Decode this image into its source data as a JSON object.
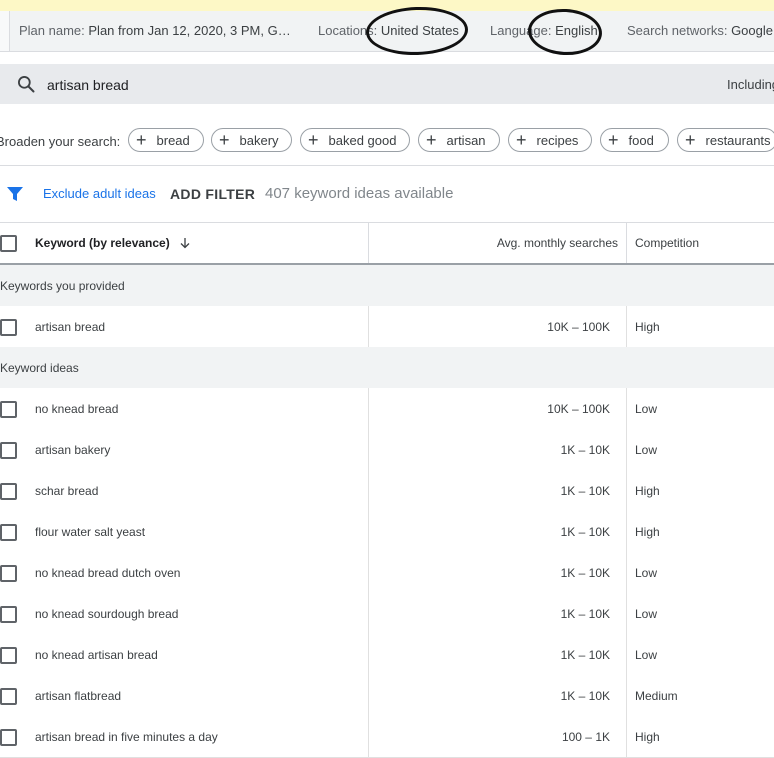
{
  "plan_bar": {
    "plan_label": "Plan name:",
    "plan_value": "Plan from Jan 12, 2020, 3 PM, G…",
    "location_label": "Locations:",
    "location_value": "United States",
    "language_label": "Language:",
    "language_value": "English",
    "networks_label": "Search networks:",
    "networks_value": "Google"
  },
  "search": {
    "query": "artisan bread",
    "right_text": "Including"
  },
  "broaden": {
    "label": "Broaden your search:",
    "chips": [
      "bread",
      "bakery",
      "baked good",
      "artisan",
      "recipes",
      "food",
      "restaurants"
    ]
  },
  "filters": {
    "exclude_label": "Exclude adult ideas",
    "add_filter_label": "ADD FILTER",
    "ideas_count": "407 keyword ideas available"
  },
  "table": {
    "headers": {
      "keyword": "Keyword (by relevance)",
      "avg": "Avg. monthly searches",
      "competition": "Competition"
    },
    "group_provided": "Keywords you provided",
    "provided_rows": [
      {
        "keyword": "artisan bread",
        "avg": "10K – 100K",
        "competition": "High"
      }
    ],
    "group_ideas": "Keyword ideas",
    "idea_rows": [
      {
        "keyword": "no knead bread",
        "avg": "10K – 100K",
        "competition": "Low"
      },
      {
        "keyword": "artisan bakery",
        "avg": "1K – 10K",
        "competition": "Low"
      },
      {
        "keyword": "schar bread",
        "avg": "1K – 10K",
        "competition": "High"
      },
      {
        "keyword": "flour water salt yeast",
        "avg": "1K – 10K",
        "competition": "High"
      },
      {
        "keyword": "no knead bread dutch oven",
        "avg": "1K – 10K",
        "competition": "Low"
      },
      {
        "keyword": "no knead sourdough bread",
        "avg": "1K – 10K",
        "competition": "Low"
      },
      {
        "keyword": "no knead artisan bread",
        "avg": "1K – 10K",
        "competition": "Low"
      },
      {
        "keyword": "artisan flatbread",
        "avg": "1K – 10K",
        "competition": "Medium"
      },
      {
        "keyword": "artisan bread in five minutes a day",
        "avg": "100 – 1K",
        "competition": "High"
      }
    ]
  },
  "icons": {
    "search": "search-icon",
    "filter": "filter-icon",
    "sort": "arrow-down-icon",
    "chip": "plus-icon"
  },
  "colors": {
    "accent": "#1a73e8",
    "header_bg": "#f1f3f4",
    "highlight": "#fdf8c6"
  }
}
